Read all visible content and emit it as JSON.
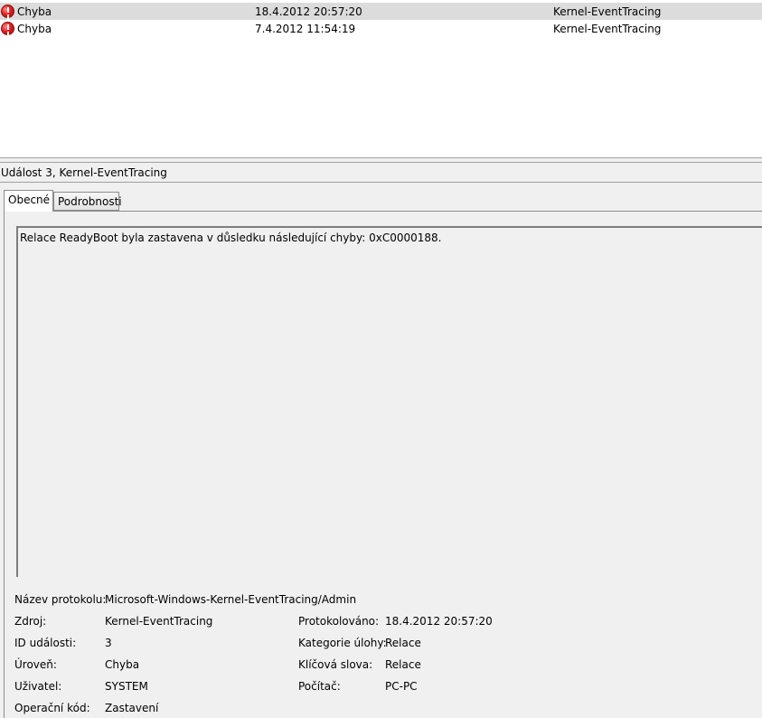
{
  "events": [
    {
      "level": "Chyba",
      "date_time": "18.4.2012 20:57:20",
      "source": "Kernel-EventTracing",
      "icon": "error-icon",
      "selected": true
    },
    {
      "level": "Chyba",
      "date_time": "7.4.2012 11:54:19",
      "source": "Kernel-EventTracing",
      "icon": "error-icon",
      "selected": false
    }
  ],
  "detail": {
    "title": "Událost 3, Kernel-EventTracing",
    "tabs": [
      {
        "label": "Obecné",
        "active": true
      },
      {
        "label": "Podrobnosti",
        "active": false
      }
    ],
    "description": "Relace ReadyBoot byla zastavena v důsledku následující chyby: 0xC0000188.",
    "properties": {
      "log_name_label": "Název protokolu:",
      "log_name": "Microsoft-Windows-Kernel-EventTracing/Admin",
      "source_label": "Zdroj:",
      "source": "Kernel-EventTracing",
      "logged_label": "Protokolováno:",
      "logged": "18.4.2012 20:57:20",
      "event_id_label": "ID události:",
      "event_id": "3",
      "task_category_label": "Kategorie úlohy:",
      "task_category": "Relace",
      "level_label": "Úroveň:",
      "level": "Chyba",
      "keywords_label": "Klíčová slova:",
      "keywords": "Relace",
      "user_label": "Uživatel:",
      "user": "SYSTEM",
      "computer_label": "Počítač:",
      "computer": "PC-PC",
      "opcode_label": "Operační kód:",
      "opcode": "Zastavení"
    }
  },
  "colors": {
    "selected_row": "#dcdcdc",
    "pane_background": "#f0f0f0",
    "error_red": "#e02020"
  }
}
